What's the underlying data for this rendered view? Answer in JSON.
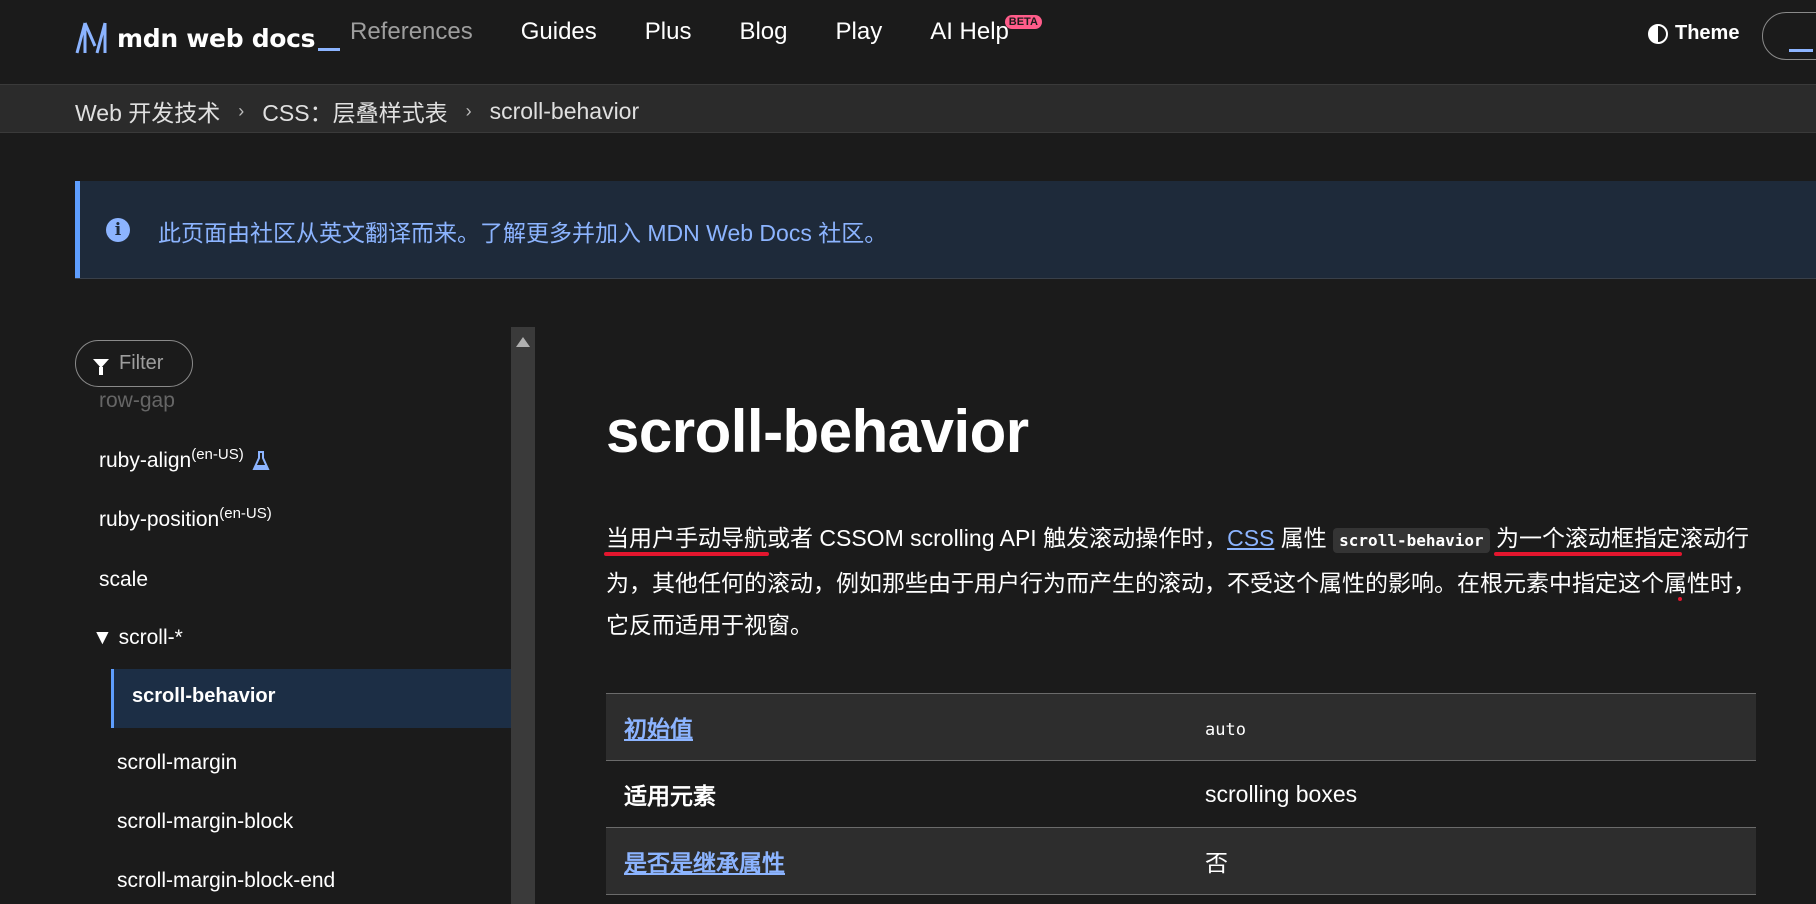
{
  "header": {
    "logo_text": "mdn web docs",
    "nav": [
      "References",
      "Guides",
      "Plus",
      "Blog",
      "Play",
      "AI Help"
    ],
    "beta_badge": "BETA",
    "theme_label": "Theme"
  },
  "breadcrumb": [
    "Web 开发技术",
    "CSS：层叠样式表",
    "scroll-behavior"
  ],
  "notice": {
    "text": "此页面由社区从英文翻译而来。了解更多并加入 MDN Web Docs 社区。",
    "accent": "#8cb4ff"
  },
  "sidebar": {
    "filter_label": "Filter",
    "items": [
      {
        "label": "row-gap"
      },
      {
        "label": "ruby-align",
        "sup": "(en-US)"
      },
      {
        "label": "ruby-position",
        "sup": "(en-US)"
      },
      {
        "label": "scale"
      },
      {
        "label": "▼ scroll-*"
      },
      {
        "label": "scroll-behavior"
      },
      {
        "label": "scroll-margin"
      },
      {
        "label": "scroll-margin-block"
      },
      {
        "label": "scroll-margin-block-end"
      }
    ]
  },
  "main": {
    "title": "scroll-behavior",
    "intro": {
      "p1": "当用户手动导航",
      "p2": "或者 CSSOM scrolling API 触发滚动操作时，",
      "css_link": "CSS",
      "p3": " 属性 ",
      "code": "scroll-behavior",
      "p4": "为一个滚动框指定",
      "p5": "滚动行为",
      "p6": "，其他任何的滚动，例如那些由于用户行为而产生的滚动，不受这个属性的影响。在根元素中指定这个属性时，它反而适用于视窗。"
    },
    "table": [
      {
        "key": "初始值",
        "value": "auto",
        "key_link": true,
        "code": true
      },
      {
        "key": "适用元素",
        "value": "scrolling boxes",
        "key_link": false,
        "code": false
      },
      {
        "key": "是否是继承属性",
        "value": "否",
        "key_link": true,
        "code": false
      }
    ],
    "highlight_color": "#e3162e"
  }
}
